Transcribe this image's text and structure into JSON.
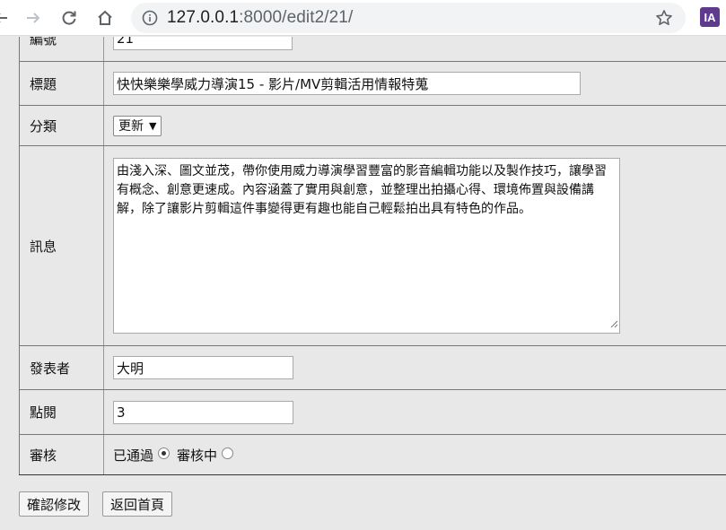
{
  "browser": {
    "url_host": "127.0.0.1",
    "url_rest": ":8000/edit2/21/",
    "extension_label": "IA"
  },
  "form": {
    "rows": {
      "id": {
        "label": "編號",
        "value": "21"
      },
      "title": {
        "label": "標題",
        "value": "快快樂樂學威力導演15 - 影片/MV剪輯活用情報特蒐"
      },
      "category": {
        "label": "分類",
        "value": "更新"
      },
      "message": {
        "label": "訊息",
        "value": "由淺入深、圖文並茂，帶你使用威力導演學習豐富的影音編輯功能以及製作技巧，讓學習有概念、創意更速成。內容涵蓋了實用與創意，並整理出拍攝心得、環境佈置與設備講解，除了讓影片剪輯這件事變得更有趣也能自己輕鬆拍出具有特色的作品。"
      },
      "author": {
        "label": "發表者",
        "value": "大明"
      },
      "views": {
        "label": "點閱",
        "value": "3"
      },
      "review": {
        "label": "審核",
        "options": [
          {
            "label": "已通過",
            "checked": true
          },
          {
            "label": "審核中",
            "checked": false
          }
        ]
      }
    }
  },
  "buttons": {
    "confirm": "確認修改",
    "back": "返回首頁"
  }
}
